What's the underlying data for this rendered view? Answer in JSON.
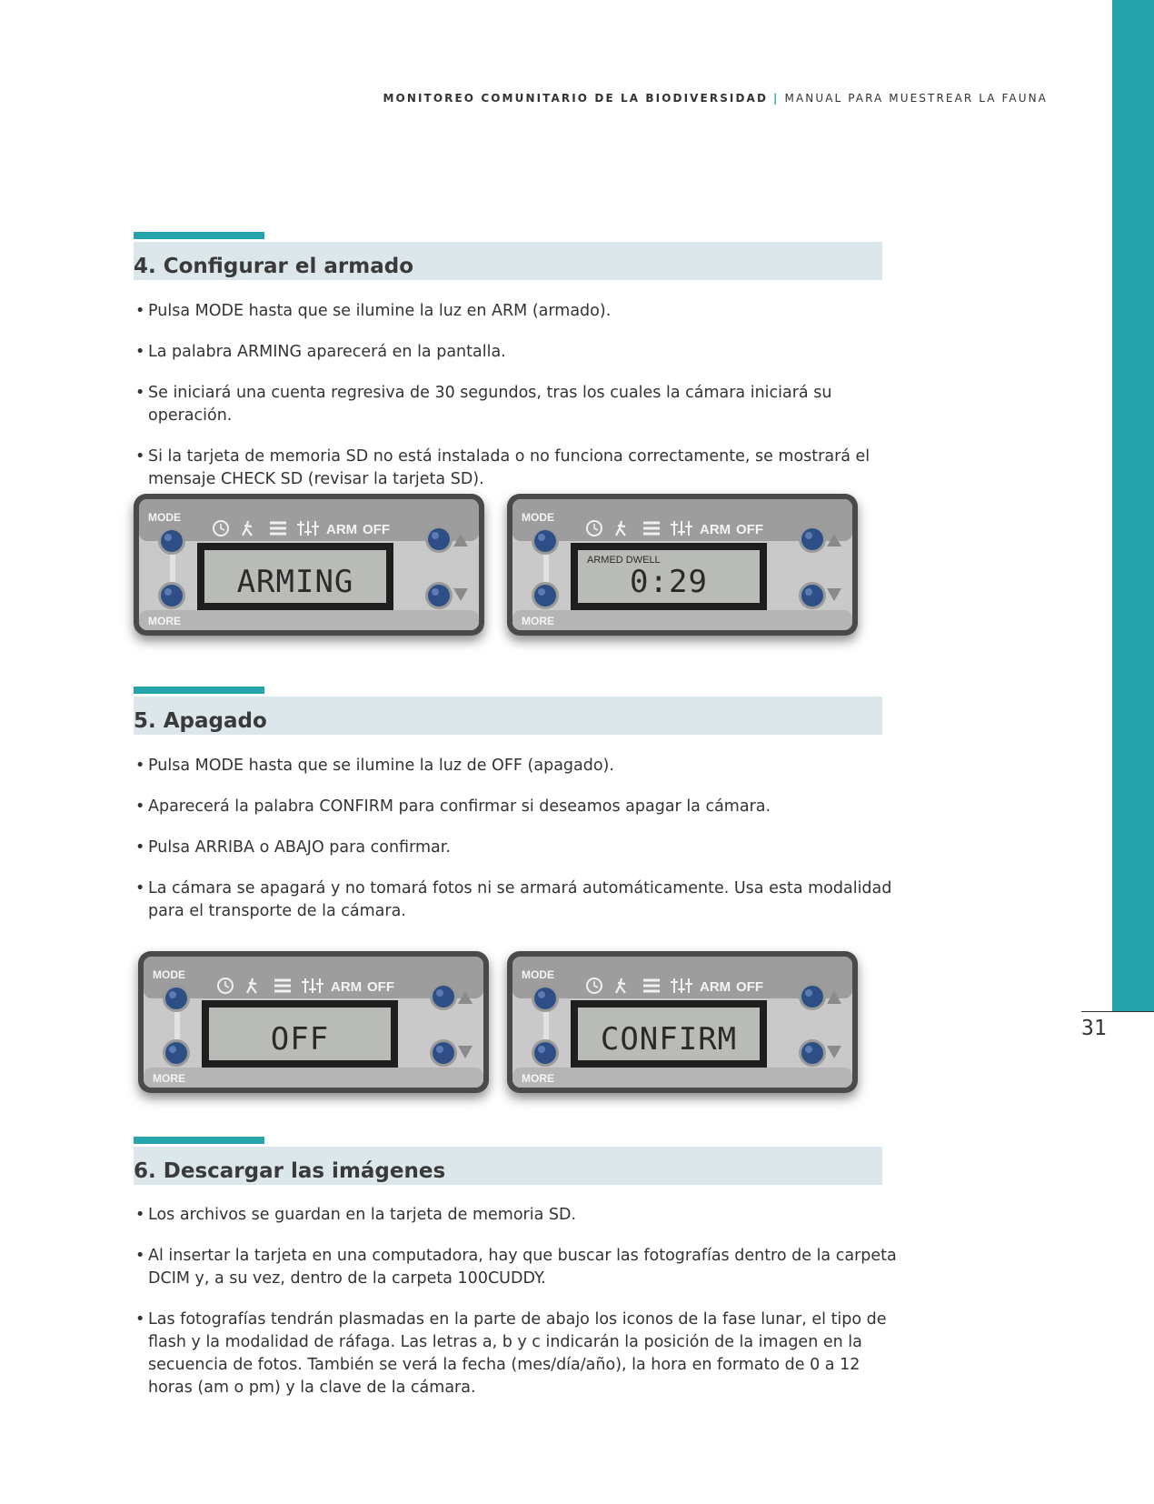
{
  "header": {
    "title": "MONITOREO COMUNITARIO DE LA BIODIVERSIDAD",
    "separator": "|",
    "subtitle": "MANUAL PARA MUESTREAR LA FAUNA"
  },
  "page_number": "31",
  "panel_labels": {
    "mode": "MODE",
    "more": "MORE",
    "arm": "ARM",
    "off": "OFF"
  },
  "sections": [
    {
      "title": "4. Configurar el armado",
      "bullets": [
        "Pulsa MODE hasta que se ilumine la luz en ARM (armado).",
        "La palabra ARMING aparecerá en la pantalla.",
        "Se iniciará una cuenta regresiva de 30 segundos, tras los cuales la cámara iniciará su operación.",
        "Si la tarjeta de memoria SD no está instalada o no funciona correctamente, se mostrará el mensaje CHECK SD (revisar la tarjeta SD)."
      ],
      "panels": [
        {
          "display": "ARMING",
          "subtext": ""
        },
        {
          "display": "0:29",
          "subtext": "ARMED   DWELL"
        }
      ]
    },
    {
      "title": "5. Apagado",
      "bullets": [
        "Pulsa MODE hasta que se ilumine la luz de OFF (apagado).",
        "Aparecerá la palabra CONFIRM para confirmar si deseamos apagar la cámara.",
        "Pulsa ARRIBA o ABAJO para confirmar.",
        "La cámara se apagará y no tomará fotos ni se armará automáticamente. Usa esta modalidad para el transporte de la cámara."
      ],
      "panels": [
        {
          "display": "OFF",
          "subtext": ""
        },
        {
          "display": "CONFIRM",
          "subtext": ""
        }
      ]
    },
    {
      "title": "6. Descargar las imágenes",
      "bullets": [
        "Los archivos se guardan en la tarjeta de memoria SD.",
        "Al insertar la tarjeta en una computadora, hay que buscar las fotografías dentro de la carpeta DCIM y, a su vez, dentro de la carpeta 100CUDDY.",
        "Las fotografías tendrán plasmadas en la parte de abajo los iconos de la fase lunar, el tipo de flash y la modalidad de ráfaga. Las letras a, b y c indicarán la posición de la imagen en la secuencia de fotos. También se verá la fecha (mes/día/año), la hora en formato de 0 a 12 horas (am o pm) y la clave de la cámara."
      ]
    }
  ]
}
